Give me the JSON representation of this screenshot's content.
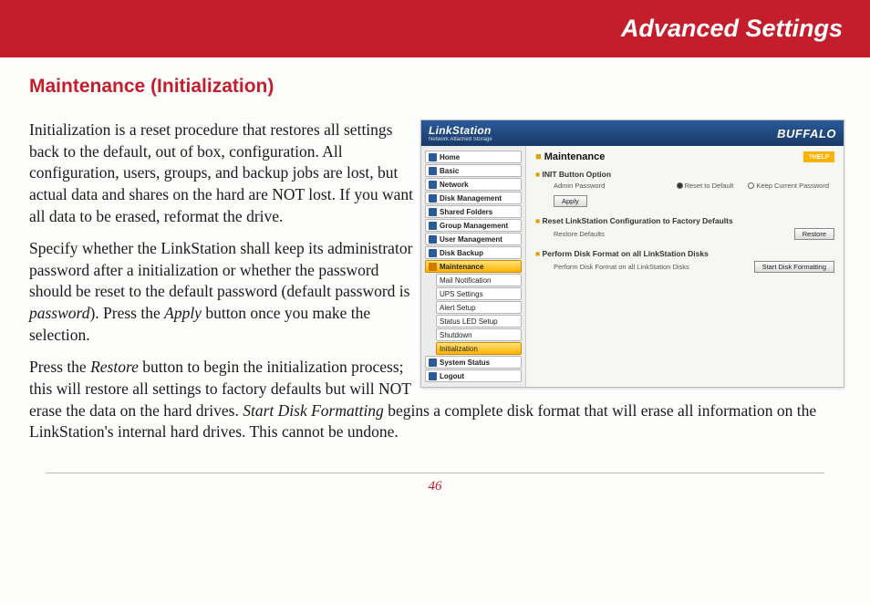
{
  "banner": "Advanced Settings",
  "section_title": "Maintenance (Initialization)",
  "para1": "Initialization is a reset procedure that restores all settings back to the default, out of box, configuration.  All configuration, users, groups, and backup jobs are lost, but actual data and shares on the hard are NOT lost.  If you want all data to be erased, reformat the drive.",
  "para2a": "Specify whether the LinkStation shall keep its administrator password after a initialization or whether the password should be reset to the default password (default password is ",
  "para2_em1": "password",
  "para2b": ").  Press the ",
  "para2_em2": "Apply",
  "para2c": " button once you make the selection.",
  "para3a": "Press the ",
  "para3_em1": "Restore",
  "para3b": " button to begin the initialization process; this will restore all settings to factory defaults but will NOT erase the data on the hard drives.  ",
  "para3_em2": "Start Disk Formatting",
  "para3c": " begins a complete disk format that will erase all information on the LinkStation's internal hard drives.  This cannot be undone.",
  "page_number": "46",
  "shot": {
    "brand_left": "LinkStation",
    "brand_left_sub": "Network Attached Storage",
    "brand_right": "BUFFALO",
    "help": "?HELP",
    "heading": "Maintenance",
    "nav": [
      "Home",
      "Basic",
      "Network",
      "Disk Management",
      "Shared Folders",
      "Group Management",
      "User Management",
      "Disk Backup"
    ],
    "nav_active": "Maintenance",
    "nav_sub": [
      "Mail Notification",
      "UPS Settings",
      "Alert Setup",
      "Status LED Setup",
      "Shutdown"
    ],
    "nav_sub_active": "Initialization",
    "nav_after": [
      "System Status",
      "Logout"
    ],
    "s1": {
      "title": "INIT Button Option",
      "label": "Admin Password",
      "opt1": "Reset to Default",
      "opt2": "Keep Current Password",
      "apply": "Apply"
    },
    "s2": {
      "title": "Reset LinkStation Configuration to Factory Defaults",
      "label": "Restore Defaults",
      "btn": "Restore"
    },
    "s3": {
      "title": "Perform Disk Format on all LinkStation Disks",
      "label": "Perform Disk Format on all LinkStation Disks",
      "btn": "Start Disk Formatting"
    }
  }
}
